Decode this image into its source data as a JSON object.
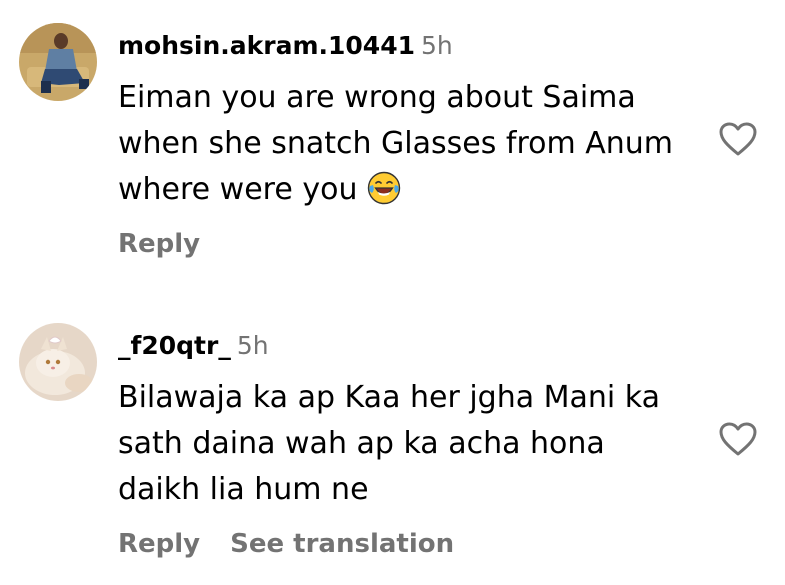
{
  "comments": [
    {
      "username": "mohsin.akram.10441",
      "time": "5h",
      "text_lines": [
        "Eiman you are wrong about Saima",
        "when she snatch Glasses from Anum",
        "where were you"
      ],
      "emoji": "face-with-tears-of-joy-icon",
      "actions": {
        "reply": "Reply"
      },
      "like_icon": "heart-outline-icon"
    },
    {
      "username": "_f20qtr_",
      "time": "5h",
      "text_lines": [
        "Bilawaja ka ap Kaa her jgha Mani ka",
        "sath daina wah ap ka acha hona",
        "daikh lia hum ne"
      ],
      "actions": {
        "reply": "Reply",
        "translate": "See translation"
      },
      "like_icon": "heart-outline-icon"
    }
  ],
  "colors": {
    "text": "#000000",
    "muted": "#737373",
    "background": "#ffffff"
  }
}
